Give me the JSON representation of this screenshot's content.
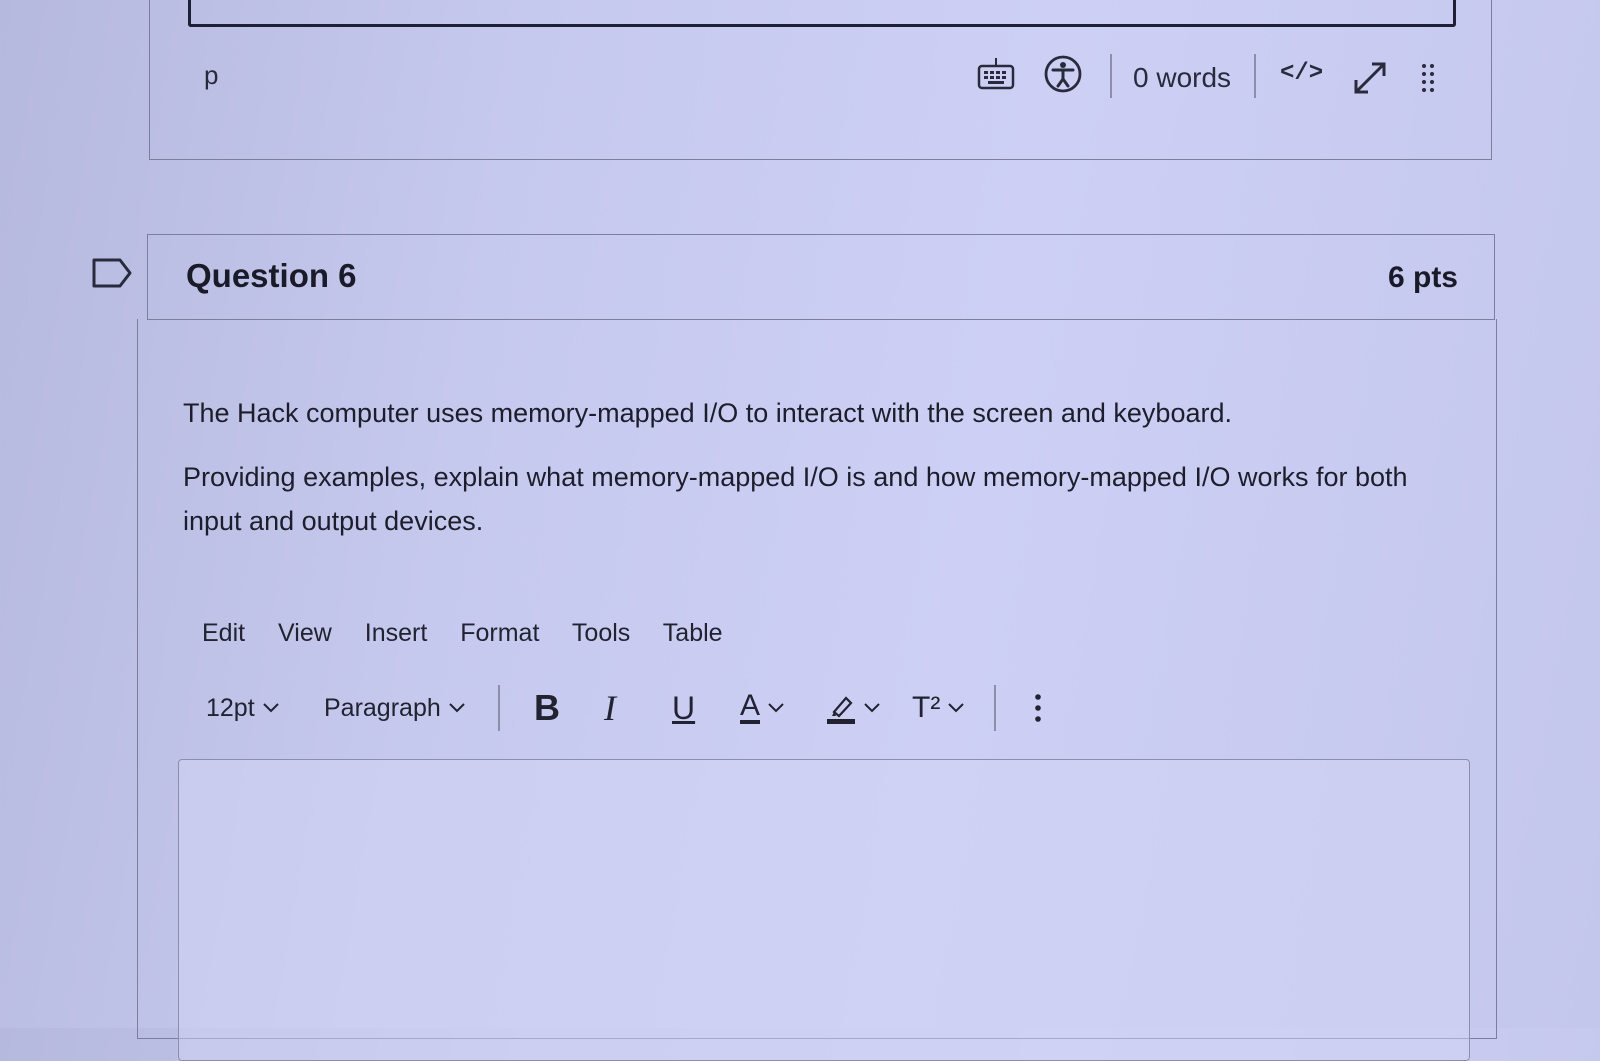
{
  "previous_editor": {
    "path": "p",
    "word_count": "0 words",
    "html_editor_label": "</>"
  },
  "question": {
    "title": "Question 6",
    "points": "6 pts",
    "text_1": "The Hack computer uses memory-mapped I/O to interact with the screen and keyboard.",
    "text_2": "Providing examples, explain what memory-mapped I/O is and how memory-mapped I/O works for both input and output devices."
  },
  "editor": {
    "menu": [
      "Edit",
      "View",
      "Insert",
      "Format",
      "Tools",
      "Table"
    ],
    "font_size": "12pt",
    "block_format": "Paragraph",
    "bold": "B",
    "italic": "I",
    "underline": "U",
    "text_color": "A",
    "superscript": "T²"
  },
  "colors": {
    "background": "#c6c9ee",
    "border": "#7c7f9a",
    "text": "#1d1e2a"
  }
}
